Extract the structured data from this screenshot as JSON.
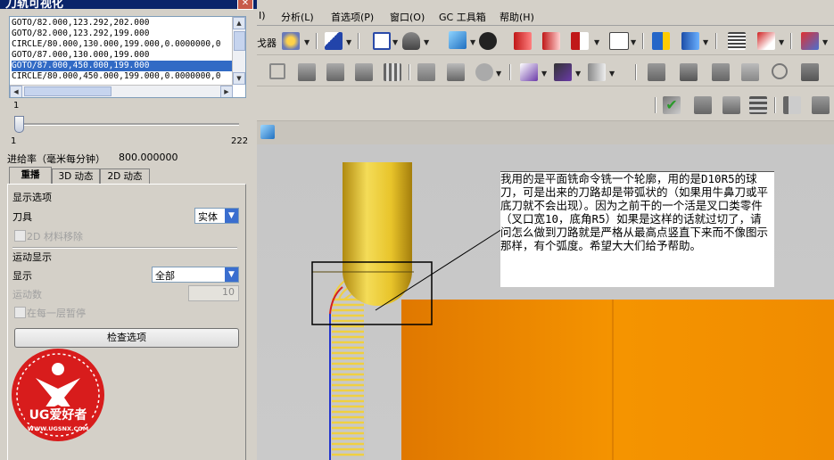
{
  "panel": {
    "title": "刀轨可视化",
    "toolpath_lines": [
      "GOTO/82.000,123.292,202.000",
      "GOTO/82.000,123.292,199.000",
      "CIRCLE/80.000,130.000,199.000,0.0000000,0",
      "GOTO/87.000,130.000,199.000",
      "GOTO/87.000,450.000,199.000",
      "CIRCLE/80.000,450.000,199.000,0.0000000,0"
    ],
    "selected_line_index": 4,
    "slider_value": "1",
    "slider_min": "1",
    "slider_max": "222",
    "slider_fraction": 0.0,
    "feedrate_label": "进给率（毫米每分钟）",
    "feedrate_value": "800.000000",
    "tabs": [
      "重播",
      "3D 动态",
      "2D 动态"
    ],
    "active_tab": "重播",
    "display_options_heading": "显示选项",
    "tool_label": "刀具",
    "tool_value": "实体",
    "material_removal_2d": "2D 材料移除",
    "motion_display_heading": "运动显示",
    "display_label": "显示",
    "display_value": "全部",
    "motion_count_label": "运动数",
    "motion_count_value": "10",
    "pause_each_layer": "在每一层暂停",
    "check_options_button": "检查选项"
  },
  "menubar": {
    "items": [
      "I)",
      "分析(L)",
      "首选项(P)",
      "窗口(O)",
      "GC 工具箱",
      "帮助(H)"
    ]
  },
  "toolbar": {
    "partial_label": "戈器"
  },
  "watermark": {
    "brand": "UG爱好者",
    "url": "WWW.UGSNX.COM"
  },
  "annotation": {
    "text": "我用的是平面铣命令铣一个轮廓，用的是D10R5的球刀，可是出来的刀路却是带弧状的（如果用牛鼻刀或平底刀就不会出现）。因为之前干的一个活是叉口类零件（叉口宽10，底角R5）如果是这样的话就过切了，请问怎么做到刀路就是严格从最高点竖直下来而不像图示那样，有个弧度。希望大大们给予帮助。"
  },
  "colors": {
    "selection": "#316ac5",
    "tool_yellow": "#e8c42a",
    "part_orange": "#f08c00",
    "toolpath_yellow": "#f0d040",
    "path_blue": "#2233cc",
    "path_red": "#d42020"
  }
}
